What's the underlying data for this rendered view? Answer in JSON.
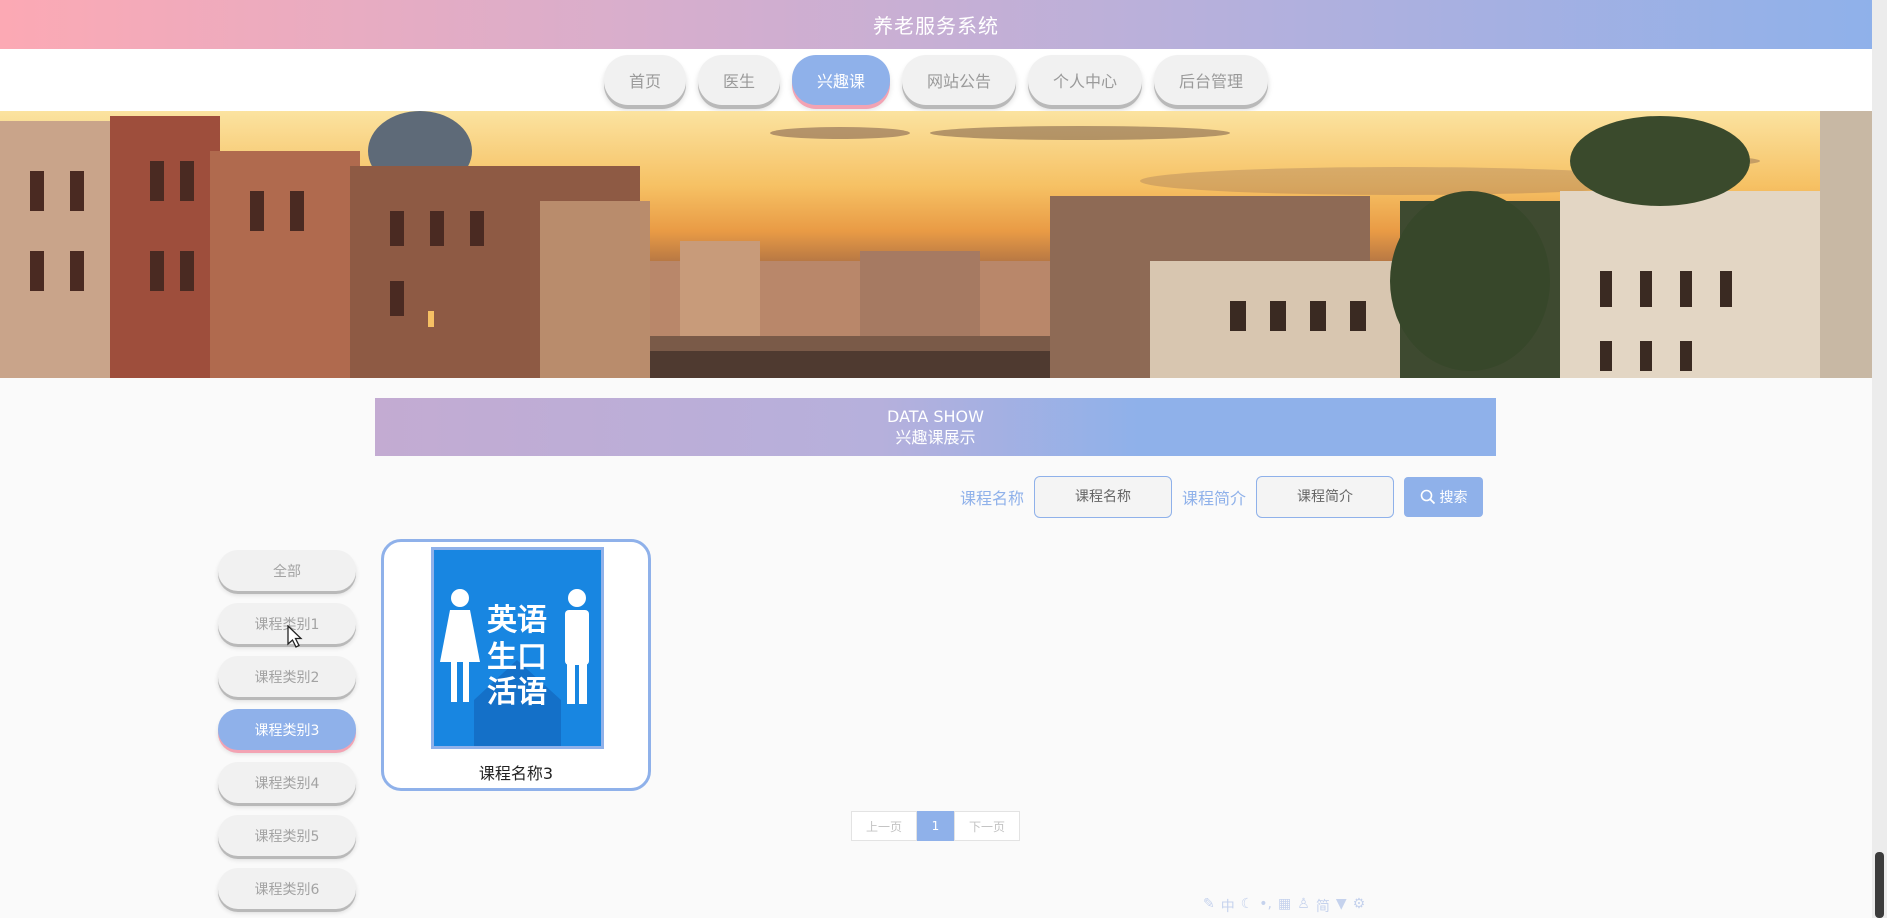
{
  "app": {
    "title": "养老服务系统"
  },
  "nav": {
    "items": [
      {
        "label": "首页",
        "active": false
      },
      {
        "label": "医生",
        "active": false
      },
      {
        "label": "兴趣课",
        "active": true
      },
      {
        "label": "网站公告",
        "active": false
      },
      {
        "label": "个人中心",
        "active": false
      },
      {
        "label": "后台管理",
        "active": false
      }
    ]
  },
  "section": {
    "title_en": "DATA SHOW",
    "title_zh": "兴趣课展示"
  },
  "search": {
    "name_label": "课程名称",
    "name_placeholder": "课程名称",
    "intro_label": "课程简介",
    "intro_placeholder": "课程简介",
    "button_label": "搜索"
  },
  "categories": [
    {
      "label": "全部",
      "active": false
    },
    {
      "label": "课程类别1",
      "active": false
    },
    {
      "label": "课程类别2",
      "active": false
    },
    {
      "label": "课程类别3",
      "active": true
    },
    {
      "label": "课程类别4",
      "active": false
    },
    {
      "label": "课程类别5",
      "active": false
    },
    {
      "label": "课程类别6",
      "active": false
    }
  ],
  "courses": [
    {
      "name": "课程名称3",
      "image_text_top": "英语",
      "image_text_mid": "生口",
      "image_text_bottom": "活语"
    }
  ],
  "pagination": {
    "prev": "上一页",
    "current": "1",
    "next": "下一页"
  },
  "ime": {
    "mode": "中",
    "simplified": "简"
  },
  "colors": {
    "accent": "#8fb1ea",
    "pink": "#fca9b4",
    "inactive_bg": "#f1f1f1",
    "inactive_text": "#a3a3a3"
  }
}
